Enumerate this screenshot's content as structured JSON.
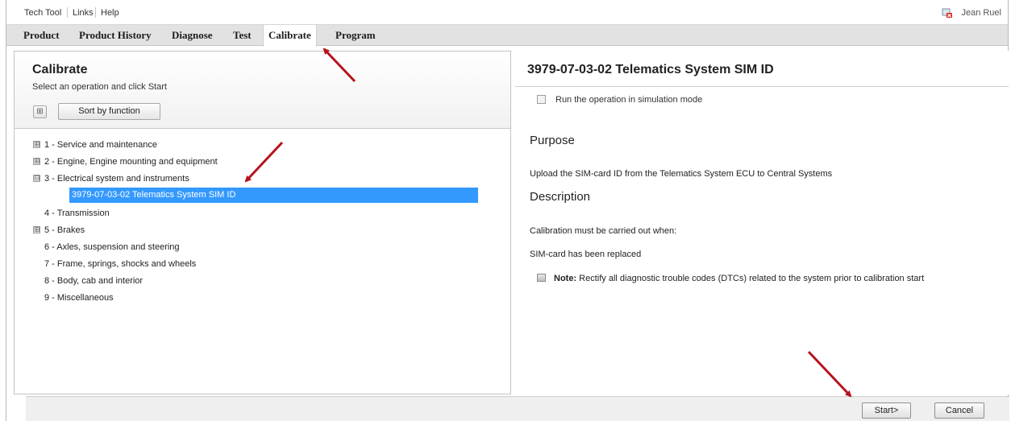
{
  "menubar": {
    "items": [
      "Tech Tool",
      "Links",
      "Help"
    ],
    "user_name": "Jean Ruel"
  },
  "tabs": [
    {
      "label": "Product"
    },
    {
      "label": "Product History"
    },
    {
      "label": "Diagnose"
    },
    {
      "label": "Test"
    },
    {
      "label": "Calibrate",
      "active": true
    },
    {
      "label": "Program"
    }
  ],
  "left": {
    "title": "Calibrate",
    "subtitle": "Select an operation and click Start",
    "expand_symbol": "⊞",
    "sort_button": "Sort by function",
    "tree": [
      {
        "label": "1 - Service and maintenance",
        "toggle": "⊞"
      },
      {
        "label": "2 - Engine, Engine mounting and equipment",
        "toggle": "⊞"
      },
      {
        "label": "3 - Electrical system and instruments",
        "toggle": "⊟"
      },
      {
        "label": "3979-07-03-02 Telematics System SIM ID",
        "selected": true
      },
      {
        "label": "4 - Transmission"
      },
      {
        "label": "5 - Brakes",
        "toggle": "⊞"
      },
      {
        "label": "6 - Axles, suspension and steering"
      },
      {
        "label": "7 - Frame, springs, shocks and wheels"
      },
      {
        "label": "8 - Body, cab and interior"
      },
      {
        "label": "9 - Miscellaneous"
      }
    ]
  },
  "right": {
    "title": "3979-07-03-02 Telematics System SIM ID",
    "simulation_label": "Run the operation in simulation mode",
    "purpose_heading": "Purpose",
    "purpose_text": "Upload the SIM-card ID from the Telematics System ECU to Central Systems",
    "description_heading": "Description",
    "desc_line1": "Calibration must be carried out when:",
    "desc_line2": "SIM-card has been replaced",
    "note_label": "Note:",
    "note_text": "Rectify all diagnostic trouble codes (DTCs) related to the system prior to calibration start"
  },
  "actions": {
    "start": "Start>",
    "cancel": "Cancel"
  },
  "colors": {
    "selection": "#3399ff",
    "arrow": "#b5121b",
    "tabbar": "#e2e2e2"
  }
}
